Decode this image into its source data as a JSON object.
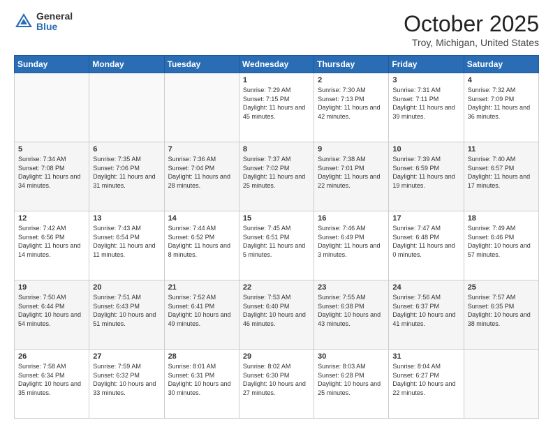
{
  "header": {
    "logo_general": "General",
    "logo_blue": "Blue",
    "month_title": "October 2025",
    "location": "Troy, Michigan, United States"
  },
  "weekdays": [
    "Sunday",
    "Monday",
    "Tuesday",
    "Wednesday",
    "Thursday",
    "Friday",
    "Saturday"
  ],
  "weeks": [
    [
      {
        "day": "",
        "info": ""
      },
      {
        "day": "",
        "info": ""
      },
      {
        "day": "",
        "info": ""
      },
      {
        "day": "1",
        "info": "Sunrise: 7:29 AM\nSunset: 7:15 PM\nDaylight: 11 hours\nand 45 minutes."
      },
      {
        "day": "2",
        "info": "Sunrise: 7:30 AM\nSunset: 7:13 PM\nDaylight: 11 hours\nand 42 minutes."
      },
      {
        "day": "3",
        "info": "Sunrise: 7:31 AM\nSunset: 7:11 PM\nDaylight: 11 hours\nand 39 minutes."
      },
      {
        "day": "4",
        "info": "Sunrise: 7:32 AM\nSunset: 7:09 PM\nDaylight: 11 hours\nand 36 minutes."
      }
    ],
    [
      {
        "day": "5",
        "info": "Sunrise: 7:34 AM\nSunset: 7:08 PM\nDaylight: 11 hours\nand 34 minutes."
      },
      {
        "day": "6",
        "info": "Sunrise: 7:35 AM\nSunset: 7:06 PM\nDaylight: 11 hours\nand 31 minutes."
      },
      {
        "day": "7",
        "info": "Sunrise: 7:36 AM\nSunset: 7:04 PM\nDaylight: 11 hours\nand 28 minutes."
      },
      {
        "day": "8",
        "info": "Sunrise: 7:37 AM\nSunset: 7:02 PM\nDaylight: 11 hours\nand 25 minutes."
      },
      {
        "day": "9",
        "info": "Sunrise: 7:38 AM\nSunset: 7:01 PM\nDaylight: 11 hours\nand 22 minutes."
      },
      {
        "day": "10",
        "info": "Sunrise: 7:39 AM\nSunset: 6:59 PM\nDaylight: 11 hours\nand 19 minutes."
      },
      {
        "day": "11",
        "info": "Sunrise: 7:40 AM\nSunset: 6:57 PM\nDaylight: 11 hours\nand 17 minutes."
      }
    ],
    [
      {
        "day": "12",
        "info": "Sunrise: 7:42 AM\nSunset: 6:56 PM\nDaylight: 11 hours\nand 14 minutes."
      },
      {
        "day": "13",
        "info": "Sunrise: 7:43 AM\nSunset: 6:54 PM\nDaylight: 11 hours\nand 11 minutes."
      },
      {
        "day": "14",
        "info": "Sunrise: 7:44 AM\nSunset: 6:52 PM\nDaylight: 11 hours\nand 8 minutes."
      },
      {
        "day": "15",
        "info": "Sunrise: 7:45 AM\nSunset: 6:51 PM\nDaylight: 11 hours\nand 5 minutes."
      },
      {
        "day": "16",
        "info": "Sunrise: 7:46 AM\nSunset: 6:49 PM\nDaylight: 11 hours\nand 3 minutes."
      },
      {
        "day": "17",
        "info": "Sunrise: 7:47 AM\nSunset: 6:48 PM\nDaylight: 11 hours\nand 0 minutes."
      },
      {
        "day": "18",
        "info": "Sunrise: 7:49 AM\nSunset: 6:46 PM\nDaylight: 10 hours\nand 57 minutes."
      }
    ],
    [
      {
        "day": "19",
        "info": "Sunrise: 7:50 AM\nSunset: 6:44 PM\nDaylight: 10 hours\nand 54 minutes."
      },
      {
        "day": "20",
        "info": "Sunrise: 7:51 AM\nSunset: 6:43 PM\nDaylight: 10 hours\nand 51 minutes."
      },
      {
        "day": "21",
        "info": "Sunrise: 7:52 AM\nSunset: 6:41 PM\nDaylight: 10 hours\nand 49 minutes."
      },
      {
        "day": "22",
        "info": "Sunrise: 7:53 AM\nSunset: 6:40 PM\nDaylight: 10 hours\nand 46 minutes."
      },
      {
        "day": "23",
        "info": "Sunrise: 7:55 AM\nSunset: 6:38 PM\nDaylight: 10 hours\nand 43 minutes."
      },
      {
        "day": "24",
        "info": "Sunrise: 7:56 AM\nSunset: 6:37 PM\nDaylight: 10 hours\nand 41 minutes."
      },
      {
        "day": "25",
        "info": "Sunrise: 7:57 AM\nSunset: 6:35 PM\nDaylight: 10 hours\nand 38 minutes."
      }
    ],
    [
      {
        "day": "26",
        "info": "Sunrise: 7:58 AM\nSunset: 6:34 PM\nDaylight: 10 hours\nand 35 minutes."
      },
      {
        "day": "27",
        "info": "Sunrise: 7:59 AM\nSunset: 6:32 PM\nDaylight: 10 hours\nand 33 minutes."
      },
      {
        "day": "28",
        "info": "Sunrise: 8:01 AM\nSunset: 6:31 PM\nDaylight: 10 hours\nand 30 minutes."
      },
      {
        "day": "29",
        "info": "Sunrise: 8:02 AM\nSunset: 6:30 PM\nDaylight: 10 hours\nand 27 minutes."
      },
      {
        "day": "30",
        "info": "Sunrise: 8:03 AM\nSunset: 6:28 PM\nDaylight: 10 hours\nand 25 minutes."
      },
      {
        "day": "31",
        "info": "Sunrise: 8:04 AM\nSunset: 6:27 PM\nDaylight: 10 hours\nand 22 minutes."
      },
      {
        "day": "",
        "info": ""
      }
    ]
  ]
}
